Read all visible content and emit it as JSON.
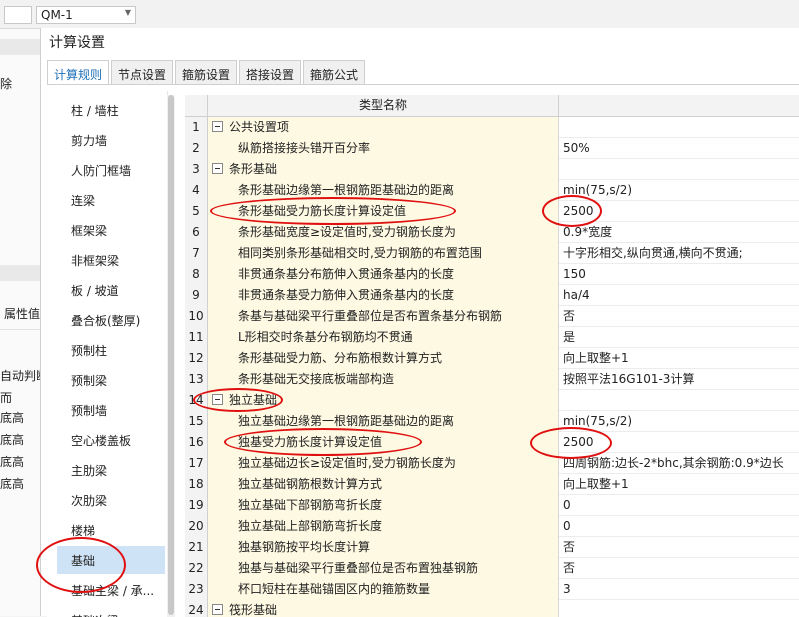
{
  "background": {
    "combo_value": "QM-1",
    "left_fragments": [
      "除",
      "属性值",
      "自动判断",
      "而",
      "底高",
      "底高",
      "底高",
      "底高"
    ]
  },
  "dialog": {
    "title": "计算设置",
    "tabs": [
      "计算规则",
      "节点设置",
      "箍筋设置",
      "搭接设置",
      "箍筋公式"
    ],
    "active_tab": "计算规则"
  },
  "categories": [
    "柱 / 墙柱",
    "剪力墙",
    "人防门框墙",
    "连梁",
    "框架梁",
    "非框架梁",
    "板 / 坡道",
    "叠合板(整厚)",
    "预制柱",
    "预制梁",
    "预制墙",
    "空心楼盖板",
    "主肋梁",
    "次肋梁",
    "楼梯",
    "基础",
    "基础主梁 / 承...",
    "基础次梁"
  ],
  "selected_category": "基础",
  "table": {
    "header": "类型名称",
    "rows": [
      {
        "num": "1",
        "name": "公共设置项",
        "value": "",
        "group": true
      },
      {
        "num": "2",
        "name": "纵筋搭接接头错开百分率",
        "value": "50%",
        "group": false
      },
      {
        "num": "3",
        "name": "条形基础",
        "value": "",
        "group": true
      },
      {
        "num": "4",
        "name": "条形基础边缘第一根钢筋距基础边的距离",
        "value": "min(75,s/2)",
        "group": false
      },
      {
        "num": "5",
        "name": "条形基础受力筋长度计算设定值",
        "value": "2500",
        "group": false
      },
      {
        "num": "6",
        "name": "条形基础宽度≥设定值时,受力钢筋长度为",
        "value": "0.9*宽度",
        "group": false
      },
      {
        "num": "7",
        "name": "相同类别条形基础相交时,受力钢筋的布置范围",
        "value": "十字形相交,纵向贯通,横向不贯通;",
        "group": false
      },
      {
        "num": "8",
        "name": "非贯通条基分布筋伸入贯通条基内的长度",
        "value": "150",
        "group": false
      },
      {
        "num": "9",
        "name": "非贯通条基受力筋伸入贯通条基内的长度",
        "value": "ha/4",
        "group": false
      },
      {
        "num": "10",
        "name": "条基与基础梁平行重叠部位是否布置条基分布钢筋",
        "value": "否",
        "group": false
      },
      {
        "num": "11",
        "name": "L形相交时条基分布钢筋均不贯通",
        "value": "是",
        "group": false
      },
      {
        "num": "12",
        "name": "条形基础受力筋、分布筋根数计算方式",
        "value": "向上取整+1",
        "group": false
      },
      {
        "num": "13",
        "name": "条形基础无交接底板端部构造",
        "value": "按照平法16G101-3计算",
        "group": false
      },
      {
        "num": "14",
        "name": "独立基础",
        "value": "",
        "group": true
      },
      {
        "num": "15",
        "name": "独立基础边缘第一根钢筋距基础边的距离",
        "value": "min(75,s/2)",
        "group": false
      },
      {
        "num": "16",
        "name": "独基受力筋长度计算设定值",
        "value": "2500",
        "group": false
      },
      {
        "num": "17",
        "name": "独立基础边长≥设定值时,受力钢筋长度为",
        "value": "四周钢筋:边长-2*bhc,其余钢筋:0.9*边长",
        "group": false
      },
      {
        "num": "18",
        "name": "独立基础钢筋根数计算方式",
        "value": "向上取整+1",
        "group": false
      },
      {
        "num": "19",
        "name": "独立基础下部钢筋弯折长度",
        "value": "0",
        "group": false
      },
      {
        "num": "20",
        "name": "独立基础上部钢筋弯折长度",
        "value": "0",
        "group": false
      },
      {
        "num": "21",
        "name": "独基钢筋按平均长度计算",
        "value": "否",
        "group": false
      },
      {
        "num": "22",
        "name": "独基与基础梁平行重叠部位是否布置独基钢筋",
        "value": "否",
        "group": false
      },
      {
        "num": "23",
        "name": "杯口短柱在基础锚固区内的箍筋数量",
        "value": "3",
        "group": false
      },
      {
        "num": "24",
        "name": "筏形基础",
        "value": "",
        "group": true
      }
    ]
  },
  "colors": {
    "annotation": "#e01010",
    "name_cell_bg": "#fdf9e3",
    "selected_bg": "#cfe3f6",
    "active_tab_text": "#1f6fb8"
  }
}
